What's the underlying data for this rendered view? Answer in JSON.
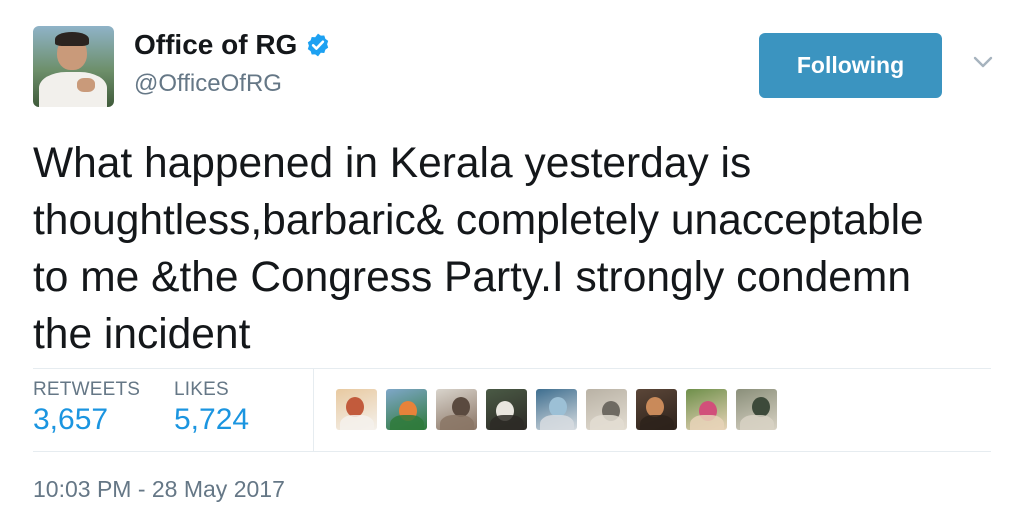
{
  "author": {
    "display_name": "Office of RG",
    "handle": "@OfficeOfRG",
    "verified": true,
    "avatar_icon": "profile-photo"
  },
  "follow_button": {
    "label": "Following"
  },
  "menu": {
    "icon": "chevron-down-icon"
  },
  "tweet": {
    "text": "What happened in Kerala yesterday is thoughtless,barbaric& completely unacceptable to me &the Congress Party.I strongly condemn the incident"
  },
  "stats": {
    "retweets_label": "RETWEETS",
    "retweets_value": "3,657",
    "likes_label": "LIKES",
    "likes_value": "5,724"
  },
  "likers": [
    {
      "name": "liker-avatar-1",
      "colors": [
        "#e8c9a0",
        "#c25b3c",
        "#f4f1ec"
      ]
    },
    {
      "name": "liker-avatar-2",
      "colors": [
        "#7fa7c9",
        "#e8823a",
        "#2f7a3b"
      ]
    },
    {
      "name": "liker-avatar-3",
      "colors": [
        "#d9d4cc",
        "#5a4a3f",
        "#8a7565"
      ]
    },
    {
      "name": "liker-avatar-4",
      "colors": [
        "#4a5a45",
        "#e9e6df",
        "#2d2a26"
      ]
    },
    {
      "name": "liker-avatar-5",
      "colors": [
        "#3e6e8f",
        "#9cc0d6",
        "#d7dce0"
      ]
    },
    {
      "name": "liker-avatar-6",
      "colors": [
        "#b9b2a5",
        "#6e6a62",
        "#e3ddd2"
      ]
    },
    {
      "name": "liker-avatar-7",
      "colors": [
        "#5b4638",
        "#c98a5a",
        "#2d221b"
      ]
    },
    {
      "name": "liker-avatar-8",
      "colors": [
        "#6e8f4a",
        "#d14f7a",
        "#e7d3b8"
      ]
    },
    {
      "name": "liker-avatar-9",
      "colors": [
        "#8a8f7a",
        "#3d4a3a",
        "#d8d2c4"
      ]
    }
  ],
  "timestamp": "10:03 PM - 28 May 2017",
  "colors": {
    "button_bg": "#3b94c0",
    "link_blue": "#1b95e0",
    "muted_gray": "#657786",
    "verified_blue": "#1da1f2"
  }
}
